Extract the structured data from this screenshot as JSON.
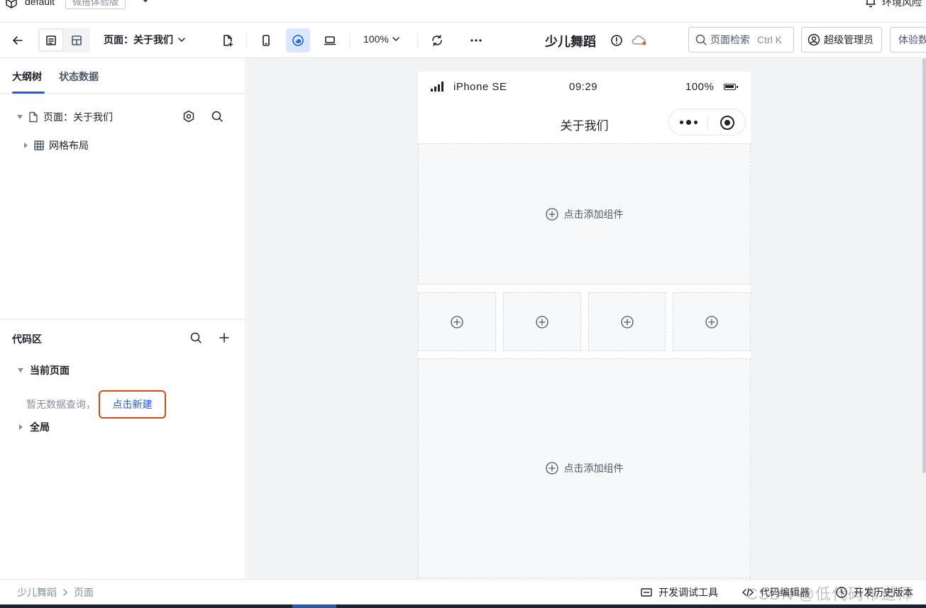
{
  "topbar": {
    "env_name": "default",
    "env_tag": "微搭体验版",
    "risk_label": "环境风险"
  },
  "toolbar": {
    "page_label": "页面：关于我们",
    "zoom": "100%",
    "app_name": "少儿舞蹈",
    "search_placeholder": "页面检索",
    "search_shortcut": "Ctrl K",
    "admin_label": "超级管理员",
    "experience_label": "体验数"
  },
  "sidebar": {
    "tabs": [
      {
        "label": "大纲树",
        "active": true
      },
      {
        "label": "状态数据",
        "active": false
      }
    ],
    "tree": {
      "page_node": "页面：关于我们",
      "child_node": "网格布局"
    },
    "code": {
      "title": "代码区",
      "current_page": "当前页面",
      "empty_text": "暂无数据查询，",
      "new_link": "点击新建",
      "global": "全局"
    }
  },
  "phone": {
    "device": "iPhone SE",
    "time": "09:29",
    "battery": "100%",
    "nav_title": "关于我们",
    "add_component": "点击添加组件"
  },
  "bottombar": {
    "crumbs": [
      "少儿舞蹈",
      "页面"
    ],
    "debug_tool": "开发调试工具",
    "code_editor": "代码编辑器",
    "history": "开发历史版本",
    "watermark": "CSDN @低代码布道师"
  },
  "colors": {
    "accent": "#1f5fde",
    "highlight_border": "#d9480f",
    "canvas_bg": "#f2f3f5"
  }
}
